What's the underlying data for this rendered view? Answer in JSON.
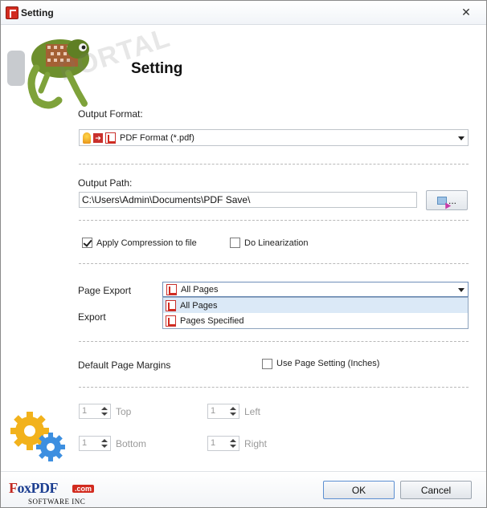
{
  "window": {
    "title": "Setting",
    "close_glyph": "✕"
  },
  "header": {
    "title": "Setting",
    "watermark": "PORTAL"
  },
  "output_format": {
    "label": "Output Format:",
    "value": "PDF Format (*.pdf)"
  },
  "output_path": {
    "label": "Output Path:",
    "value": "C:\\Users\\Admin\\Documents\\PDF Save\\",
    "browse_label": "..."
  },
  "options": {
    "compression": {
      "label": "Apply Compression to file",
      "checked": true
    },
    "linearization": {
      "label": "Do Linearization",
      "checked": false
    }
  },
  "page_export": {
    "label": "Page Export",
    "selected": "All Pages",
    "options": [
      "All Pages",
      "Pages Specified"
    ]
  },
  "export": {
    "label": "Export"
  },
  "margins": {
    "label": "Default Page Margins",
    "use_page_setting": {
      "label": "Use Page Setting (Inches)",
      "checked": false
    },
    "top": {
      "label": "Top",
      "value": "1"
    },
    "left": {
      "label": "Left",
      "value": "1"
    },
    "bottom": {
      "label": "Bottom",
      "value": "1"
    },
    "right": {
      "label": "Right",
      "value": "1"
    }
  },
  "footer": {
    "brand_fx": "F",
    "brand_rest": "oxPDF",
    "brand_com": ".com",
    "brand_sub": "SOFTWARE INC",
    "ok_label": "OK",
    "cancel_label": "Cancel"
  }
}
